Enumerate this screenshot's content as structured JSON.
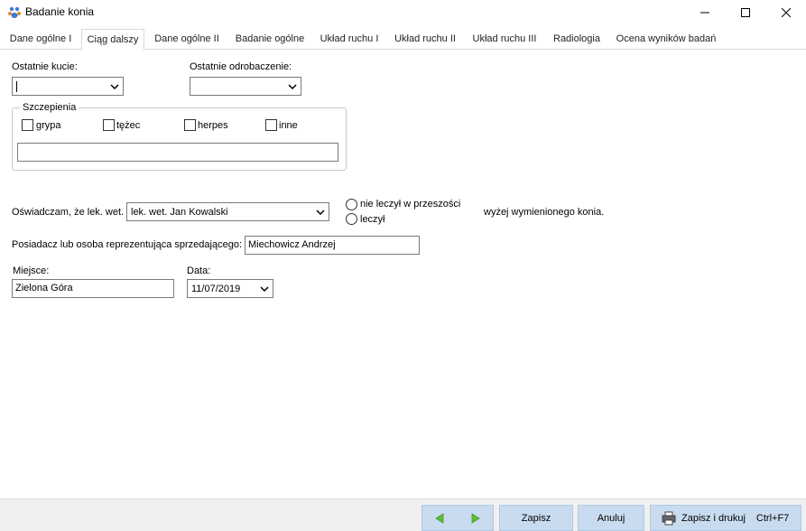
{
  "window": {
    "title": "Badanie konia",
    "icon": "horse-app-icon",
    "controls": [
      "minimize-icon",
      "maximize-icon",
      "close-icon"
    ]
  },
  "tabs": [
    {
      "label": "Dane ogólne I",
      "active": false
    },
    {
      "label": "Ciąg dalszy",
      "active": true
    },
    {
      "label": "Dane ogólne II",
      "active": false
    },
    {
      "label": "Badanie ogólne",
      "active": false
    },
    {
      "label": "Układ ruchu I",
      "active": false
    },
    {
      "label": "Układ ruchu II",
      "active": false
    },
    {
      "label": "Układ ruchu III",
      "active": false
    },
    {
      "label": "Radiologia",
      "active": false
    },
    {
      "label": "Ocena wyników badań",
      "active": false
    }
  ],
  "form": {
    "ostatnie_kucie_label": "Ostatnie kucie:",
    "ostatnie_kucie_value": "",
    "ostatnie_odrobaczenie_label": "Ostatnie odrobaczenie:",
    "ostatnie_odrobaczenie_value": "",
    "szczepienia": {
      "legend": "Szczepienia",
      "options": [
        {
          "label": "grypa",
          "checked": false
        },
        {
          "label": "tężec",
          "checked": false
        },
        {
          "label": "herpes",
          "checked": false
        },
        {
          "label": "inne",
          "checked": false
        }
      ],
      "inne_value": ""
    },
    "oswiadczam_label": "Oświadczam, że lek. wet.",
    "lekarz_value": "lek. wet. Jan Kowalski",
    "radio_options": [
      {
        "label": "nie leczył w przeszości",
        "selected": false
      },
      {
        "label": "leczył",
        "selected": false
      }
    ],
    "suffix_text": "wyżej wymienionego konia.",
    "posiadacz_label": "Posiadacz lub osoba reprezentująca sprzedającego:",
    "posiadacz_value": "Miechowicz Andrzej",
    "miejsce_label": "Miejsce:",
    "miejsce_value": "Zielona Góra",
    "data_label": "Data:",
    "data_value": "11/07/2019"
  },
  "buttons": {
    "prev_icon": "arrow-left-icon",
    "next_icon": "arrow-right-icon",
    "save": "Zapisz",
    "cancel": "Anuluj",
    "save_print": "Zapisz i drukuj",
    "save_print_shortcut": "Ctrl+F7"
  },
  "colors": {
    "button_bg": "#c9dcef",
    "arrow_green": "#5cc13a"
  }
}
